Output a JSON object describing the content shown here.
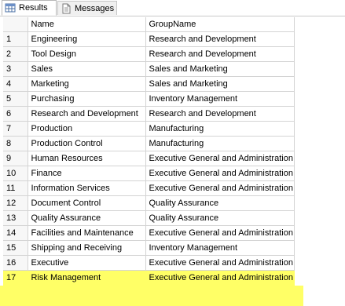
{
  "tabs": {
    "results_label": "Results",
    "messages_label": "Messages"
  },
  "grid": {
    "columns": [
      "Name",
      "GroupName"
    ],
    "rows": [
      {
        "num": "1",
        "name": "Engineering",
        "group": "Research and Development"
      },
      {
        "num": "2",
        "name": "Tool Design",
        "group": "Research and Development"
      },
      {
        "num": "3",
        "name": "Sales",
        "group": "Sales and Marketing"
      },
      {
        "num": "4",
        "name": "Marketing",
        "group": "Sales and Marketing"
      },
      {
        "num": "5",
        "name": "Purchasing",
        "group": "Inventory Management"
      },
      {
        "num": "6",
        "name": "Research and Development",
        "group": "Research and Development"
      },
      {
        "num": "7",
        "name": "Production",
        "group": "Manufacturing"
      },
      {
        "num": "8",
        "name": "Production Control",
        "group": "Manufacturing"
      },
      {
        "num": "9",
        "name": "Human Resources",
        "group": "Executive General and Administration"
      },
      {
        "num": "10",
        "name": "Finance",
        "group": "Executive General and Administration"
      },
      {
        "num": "11",
        "name": "Information Services",
        "group": "Executive General and Administration"
      },
      {
        "num": "12",
        "name": "Document Control",
        "group": "Quality Assurance"
      },
      {
        "num": "13",
        "name": "Quality Assurance",
        "group": "Quality Assurance"
      },
      {
        "num": "14",
        "name": "Facilities and Maintenance",
        "group": "Executive General and Administration"
      },
      {
        "num": "15",
        "name": "Shipping and Receiving",
        "group": "Inventory Management"
      },
      {
        "num": "16",
        "name": "Executive",
        "group": "Executive General and Administration"
      },
      {
        "num": "17",
        "name": "Risk Management",
        "group": "Executive General and Administration"
      }
    ],
    "highlight_color": "#ffff66"
  }
}
